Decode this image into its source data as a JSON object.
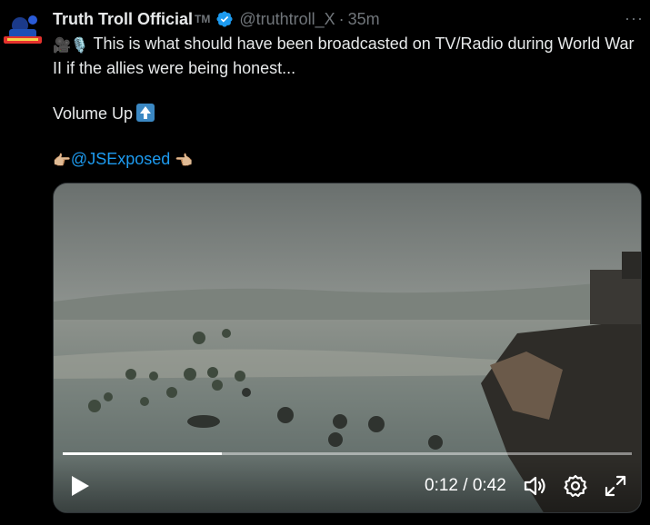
{
  "post": {
    "author_name": "Truth Troll Official",
    "author_suffix": "TM",
    "handle": "@truthtroll_X",
    "separator": "·",
    "time": "35m",
    "more": "···",
    "text_line1": "This is what should have been broadcasted on TV/Radio during World War II if the allies were being honest...",
    "text_line2": "Volume Up",
    "mention": "@JSExposed",
    "emoji_lead": "🎥🎙️",
    "emoji_point_right": "👉🏼",
    "emoji_point_left": "👈🏼"
  },
  "video": {
    "current_time": "0:12",
    "time_separator": " / ",
    "duration": "0:42",
    "progress_fraction": 0.28
  },
  "colors": {
    "background": "#000000",
    "text_primary": "#e7e9ea",
    "text_secondary": "#71767b",
    "link": "#1d9bf0",
    "verified": "#1d9bf0"
  },
  "icons": [
    "avatar",
    "verified-badge-icon",
    "more-options-icon",
    "up-arrow-icon",
    "play-icon",
    "volume-icon",
    "settings-gear-icon",
    "fullscreen-icon"
  ]
}
